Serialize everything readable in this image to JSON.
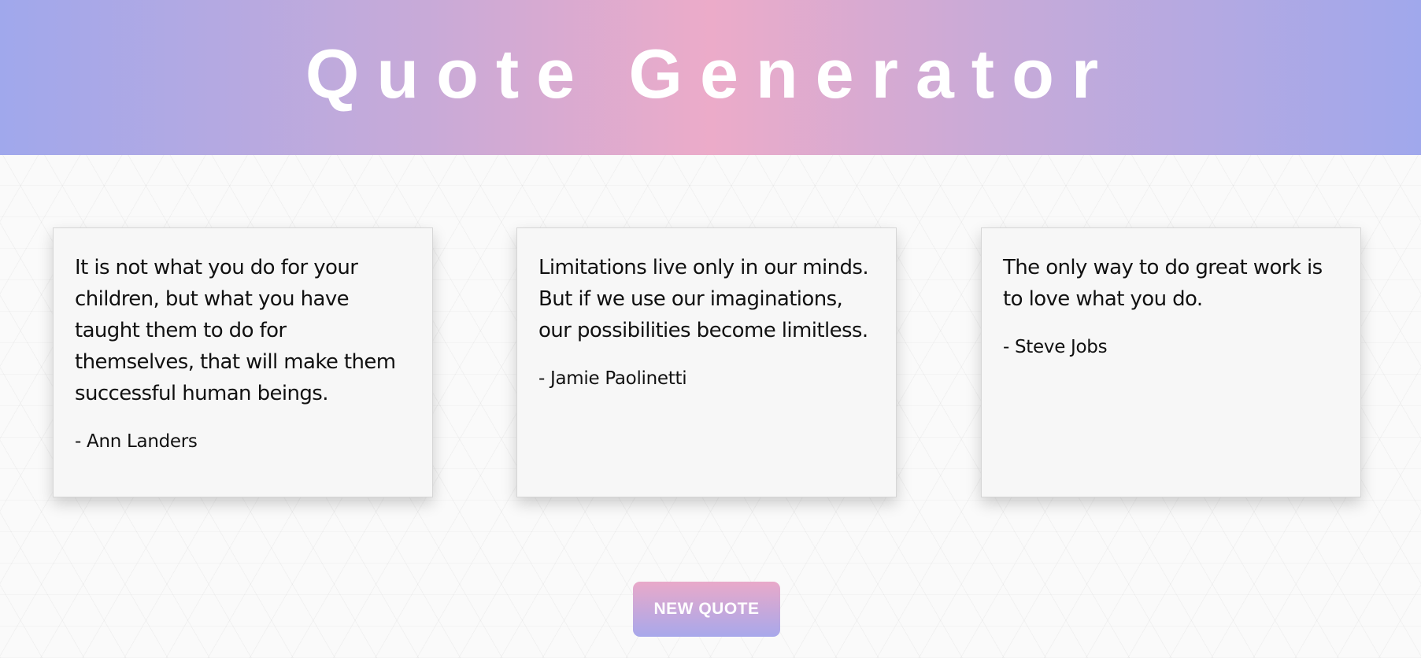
{
  "header": {
    "title": "Quote Generator"
  },
  "quotes": [
    {
      "text": "It is not what you do for your children, but what you have taught them to do for themselves, that will make them successful human beings.",
      "author": "- Ann Landers"
    },
    {
      "text": "Limitations live only in our minds. But if we use our imaginations, our possibilities become limitless.",
      "author": "- Jamie Paolinetti"
    },
    {
      "text": "The only way to do great work is to love what you do.",
      "author": "- Steve Jobs"
    }
  ],
  "actions": {
    "new_quote_label": "NEW QUOTE"
  },
  "colors": {
    "header_gradient_edge": "#a0a8ec",
    "header_gradient_center": "#ecabc9",
    "button_top": "#e9a9c9",
    "button_bottom": "#a8a8eb"
  }
}
